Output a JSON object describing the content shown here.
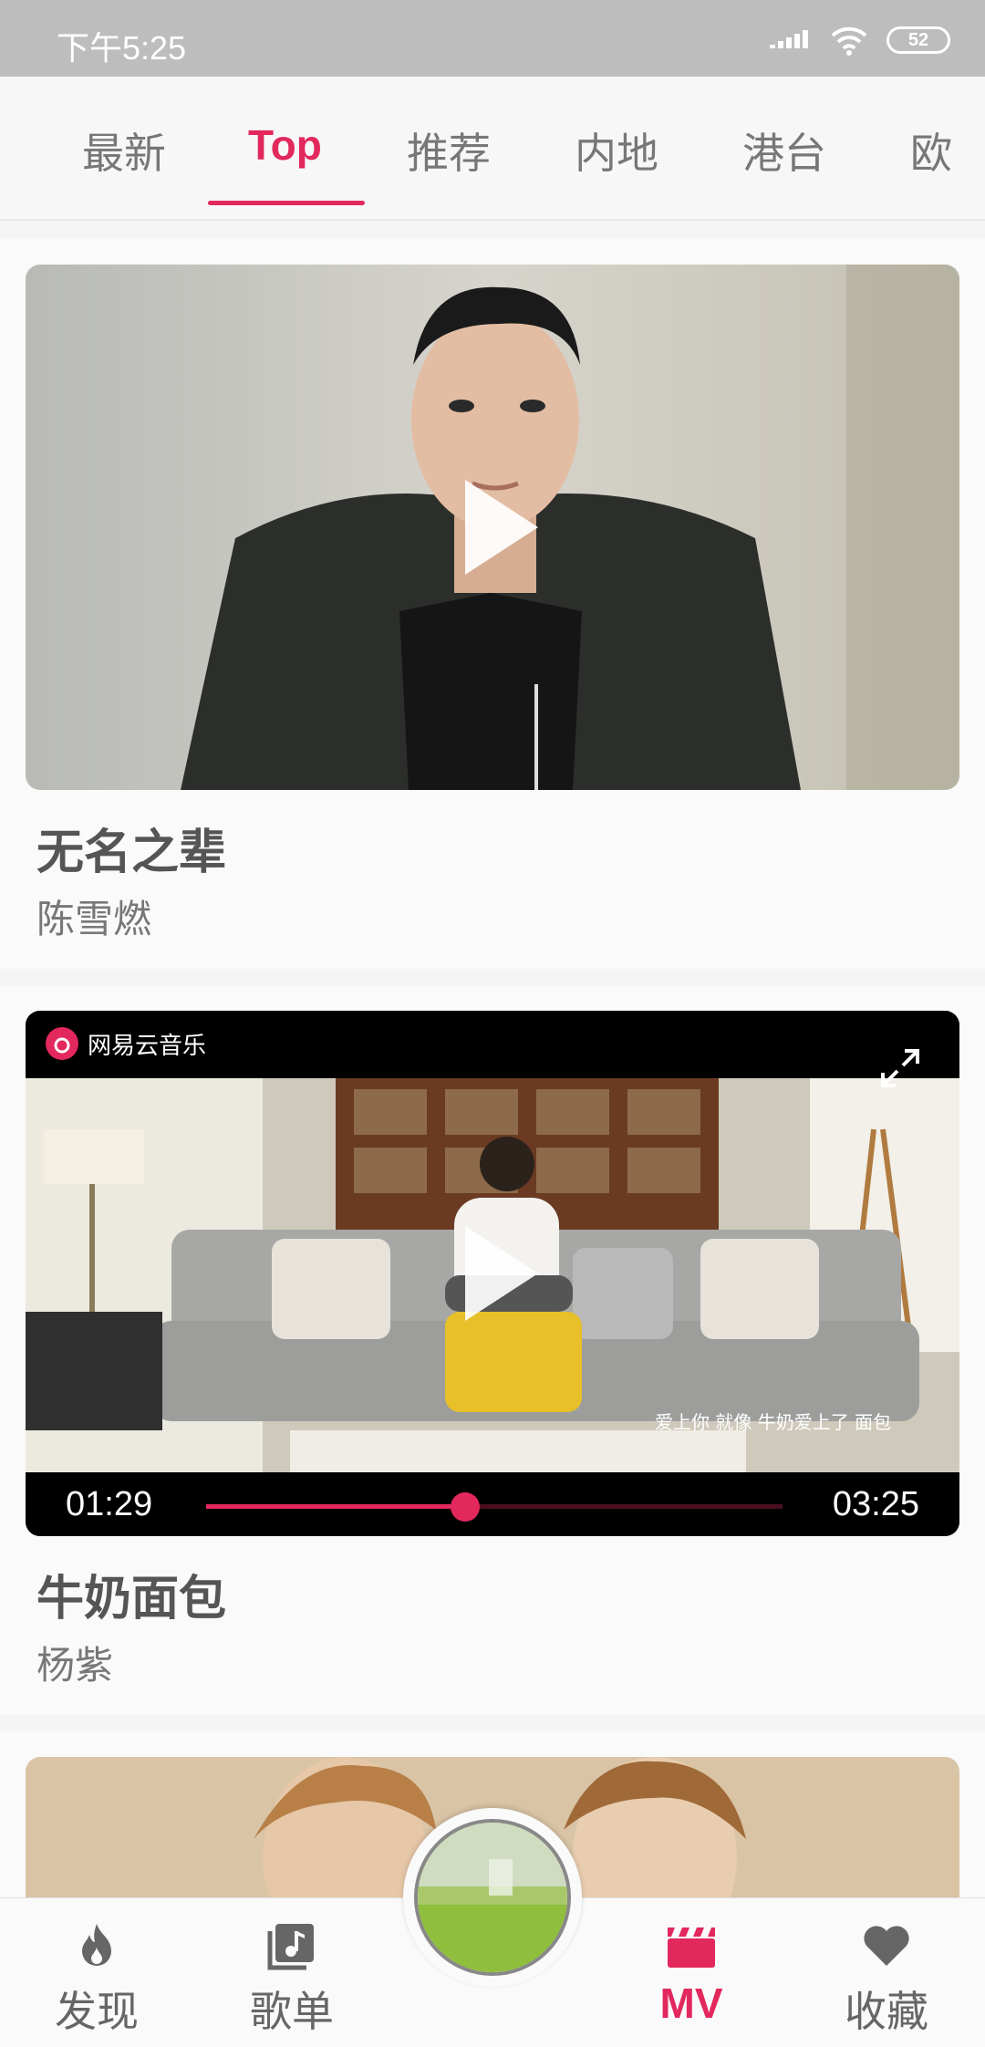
{
  "status_bar": {
    "time": "下午5:25",
    "battery": "52"
  },
  "tabs": [
    {
      "label": "最新",
      "active": false
    },
    {
      "label": "Top",
      "active": true
    },
    {
      "label": "推荐",
      "active": false
    },
    {
      "label": "内地",
      "active": false
    },
    {
      "label": "港台",
      "active": false
    },
    {
      "label": "欧",
      "active": false
    }
  ],
  "videos": [
    {
      "title": "无名之辈",
      "artist": "陈雪燃"
    },
    {
      "title": "牛奶面包",
      "artist": "杨紫",
      "player": {
        "current_time": "01:29",
        "total_time": "03:25",
        "progress": 0.45,
        "watermark": "网易云音乐",
        "subtitle": "爱上你 就像 牛奶爱上了 面包"
      }
    }
  ],
  "bottom_nav": [
    {
      "label": "发现",
      "icon": "flame-icon",
      "active": false
    },
    {
      "label": "歌单",
      "icon": "playlist-icon",
      "active": false
    },
    {
      "label": "MV",
      "icon": "clapperboard-icon",
      "active": true
    },
    {
      "label": "收藏",
      "icon": "heart-icon",
      "active": false
    }
  ],
  "colors": {
    "accent": "#e2285d",
    "text": "#555555",
    "status_bar": "#bdbdbd"
  }
}
